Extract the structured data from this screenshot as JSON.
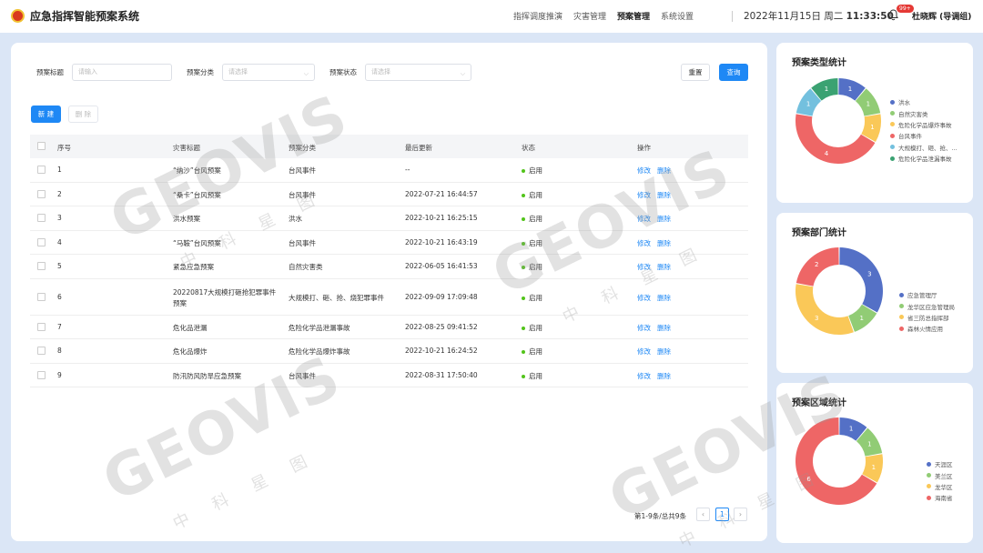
{
  "header": {
    "app_title": "应急指挥智能预案系统",
    "nav": [
      "指挥调度推演",
      "灾害管理",
      "预案管理",
      "系统设置"
    ],
    "active_nav": "预案管理",
    "date": "2022年11月15日 周二",
    "time": "11:33:50",
    "notification_badge": "99+",
    "user": "杜晓辉 (导调组)"
  },
  "filters": {
    "title_label": "预案标题",
    "title_placeholder": "请输入",
    "category_label": "预案分类",
    "category_placeholder": "请选择",
    "status_label": "预案状态",
    "status_placeholder": "请选择",
    "reset_label": "重置",
    "search_label": "查询"
  },
  "actions": {
    "new_label": "新 建",
    "delete_label": "删 除"
  },
  "table": {
    "headers": [
      "序号",
      "灾害标题",
      "预案分类",
      "最后更新",
      "状态",
      "操作"
    ],
    "rows": [
      {
        "no": "1",
        "title": "“纳沙”台风预案",
        "category": "台风事件",
        "updated": "--",
        "status": "启用",
        "edit": "修改",
        "del": "删除"
      },
      {
        "no": "2",
        "title": "“桑卡”台风预案",
        "category": "台风事件",
        "updated": "2022-07-21 16:44:57",
        "status": "启用",
        "edit": "修改",
        "del": "删除"
      },
      {
        "no": "3",
        "title": "洪水预案",
        "category": "洪水",
        "updated": "2022-10-21 16:25:15",
        "status": "启用",
        "edit": "修改",
        "del": "删除"
      },
      {
        "no": "4",
        "title": "“马鞍”台风预案",
        "category": "台风事件",
        "updated": "2022-10-21 16:43:19",
        "status": "启用",
        "edit": "修改",
        "del": "删除"
      },
      {
        "no": "5",
        "title": "紧急应急预案",
        "category": "自然灾害类",
        "updated": "2022-06-05 16:41:53",
        "status": "启用",
        "edit": "修改",
        "del": "删除"
      },
      {
        "no": "6",
        "title": "20220817大规模打砸抢犯罪事件预案",
        "category": "大规模打、砸、抢、烧犯罪事件",
        "updated": "2022-09-09 17:09:48",
        "status": "启用",
        "edit": "修改",
        "del": "删除"
      },
      {
        "no": "7",
        "title": "危化品泄漏",
        "category": "危险化学品泄漏事故",
        "updated": "2022-08-25 09:41:52",
        "status": "启用",
        "edit": "修改",
        "del": "删除"
      },
      {
        "no": "8",
        "title": "危化品爆炸",
        "category": "危险化学品爆炸事故",
        "updated": "2022-10-21 16:24:52",
        "status": "启用",
        "edit": "修改",
        "del": "删除"
      },
      {
        "no": "9",
        "title": "防汛防风防旱应急预案",
        "category": "台风事件",
        "updated": "2022-08-31 17:50:40",
        "status": "启用",
        "edit": "修改",
        "del": "删除"
      }
    ]
  },
  "pagination": {
    "summary": "第1-9条/总共9条",
    "current_page": "1",
    "prev": "‹",
    "next": "›"
  },
  "charts": {
    "type_stats": {
      "title": "预案类型统计",
      "legend": [
        "洪水",
        "自然灾害类",
        "危险化学品爆炸事故",
        "台风事件",
        "大规模打、砸、抢、...",
        "危险化学品泄漏事故"
      ],
      "values": [
        1,
        1,
        1,
        4,
        1,
        1
      ],
      "colors": [
        "#5470c6",
        "#91cc75",
        "#fac858",
        "#ee6666",
        "#73c0de",
        "#3ba272"
      ]
    },
    "dept_stats": {
      "title": "预案部门统计",
      "legend": [
        "应急管理厅",
        "龙华区应急管理局",
        "省三防总指挥部",
        "森林火情应用"
      ],
      "values": [
        3,
        1,
        3,
        2
      ],
      "colors": [
        "#5470c6",
        "#91cc75",
        "#fac858",
        "#ee6666"
      ]
    },
    "region_stats": {
      "title": "预案区域统计",
      "legend": [
        "天涯区",
        "美兰区",
        "龙华区",
        "海南省"
      ],
      "values": [
        1,
        1,
        1,
        6
      ],
      "colors": [
        "#5470c6",
        "#91cc75",
        "#fac858",
        "#ee6666"
      ]
    }
  },
  "watermark": {
    "brand": "GEOVIS",
    "sub": "中 科 星 图"
  }
}
